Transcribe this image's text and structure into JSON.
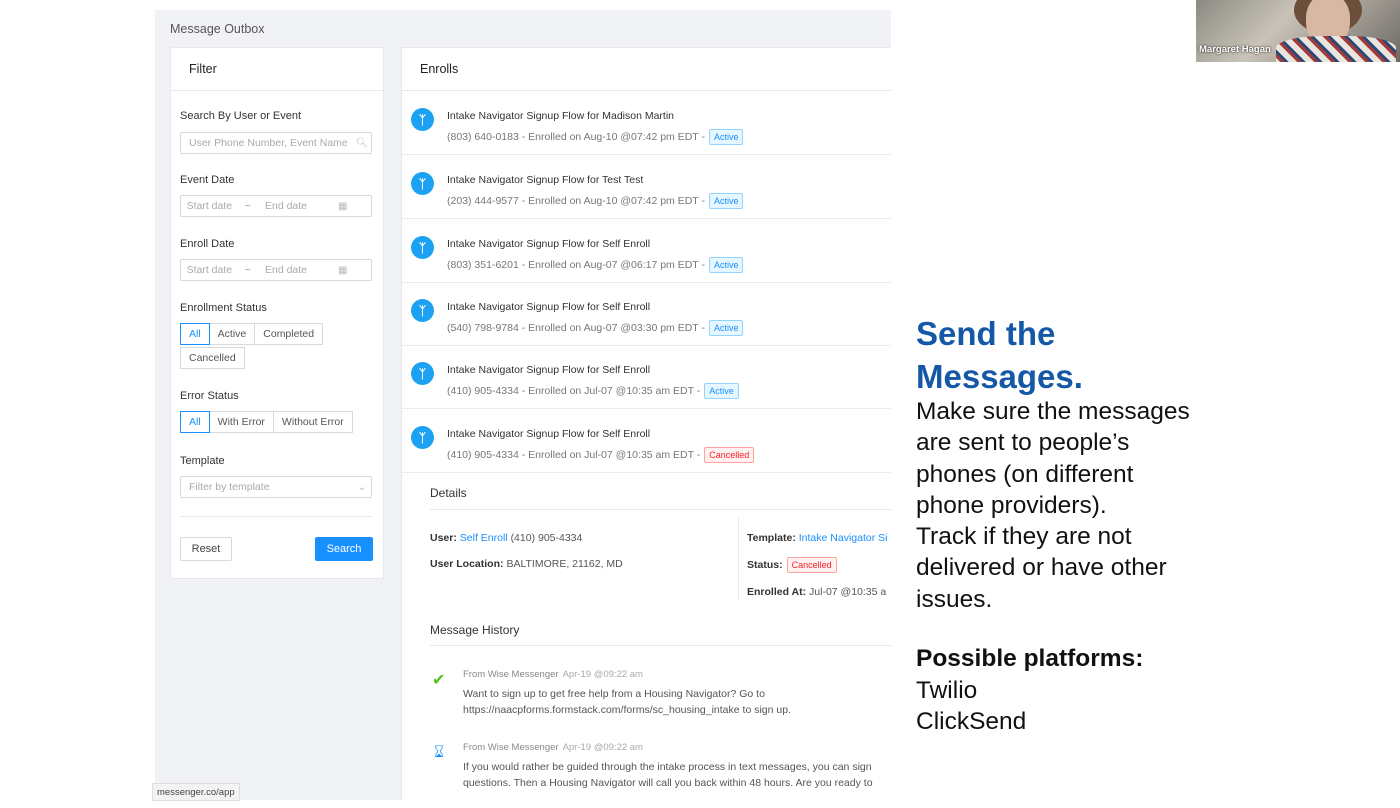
{
  "app": {
    "title": "Message Outbox",
    "filter": {
      "heading": "Filter",
      "search_label": "Search By User or Event",
      "search_placeholder": "User Phone Number, Event Name",
      "event_date_label": "Event Date",
      "enroll_date_label": "Enroll Date",
      "start_date_placeholder": "Start date",
      "end_date_placeholder": "End date",
      "date_separator": "~",
      "enrollment_status_label": "Enrollment Status",
      "enrollment_status_options": [
        "All",
        "Active",
        "Completed",
        "Cancelled"
      ],
      "enrollment_status_selected": "All",
      "error_status_label": "Error Status",
      "error_status_options": [
        "All",
        "With Error",
        "Without Error"
      ],
      "error_status_selected": "All",
      "template_label": "Template",
      "template_placeholder": "Filter by template",
      "reset_label": "Reset",
      "search_button_label": "Search"
    },
    "enrolls": {
      "heading": "Enrolls",
      "items": [
        {
          "title": "Intake Navigator Signup Flow for Madison Martin",
          "detail": "(803) 640-0183 - Enrolled on Aug-10 @07:42 pm EDT -",
          "status": "Active"
        },
        {
          "title": "Intake Navigator Signup Flow for Test Test",
          "detail": "(203) 444-9577 - Enrolled on Aug-10 @07:42 pm EDT -",
          "status": "Active"
        },
        {
          "title": "Intake Navigator Signup Flow for Self Enroll",
          "detail": "(803) 351-6201 - Enrolled on Aug-07 @06:17 pm EDT -",
          "status": "Active"
        },
        {
          "title": "Intake Navigator Signup Flow for Self Enroll",
          "detail": "(540) 798-9784 - Enrolled on Aug-07 @03:30 pm EDT -",
          "status": "Active"
        },
        {
          "title": "Intake Navigator Signup Flow for Self Enroll",
          "detail": "(410) 905-4334 - Enrolled on Jul-07 @10:35 am EDT -",
          "status": "Active"
        },
        {
          "title": "Intake Navigator Signup Flow for Self Enroll",
          "detail": "(410) 905-4334 - Enrolled on Jul-07 @10:35 am EDT -",
          "status": "Cancelled"
        }
      ]
    },
    "details": {
      "heading": "Details",
      "user_label": "User:",
      "user_link": "Self Enroll",
      "user_phone": "(410) 905-4334",
      "location_label": "User Location:",
      "location_value": "BALTIMORE, 21162, MD",
      "template_label": "Template:",
      "template_value": "Intake Navigator Si",
      "status_label": "Status:",
      "status_value": "Cancelled",
      "enrolled_label": "Enrolled At:",
      "enrolled_value": "Jul-07 @10:35 a"
    },
    "message_history": {
      "heading": "Message History",
      "messages": [
        {
          "icon": "check-circle-icon",
          "from": "From Wise Messenger",
          "time": "Apr-19 @09:22 am",
          "line1": "Want to sign up to get free help from a Housing Navigator? Go to",
          "line2": "https://naacpforms.formstack.com/forms/sc_housing_intake to sign up."
        },
        {
          "icon": "hourglass-icon",
          "from": "From Wise Messenger",
          "time": "Apr-19 @09:22 am",
          "line1": "If you would rather be guided through the intake process in text messages, you can sign",
          "line2": "questions. Then a Housing Navigator will call you back within 48 hours. Are you ready to"
        }
      ]
    },
    "status_bar_url": "messenger.co/app"
  },
  "slide": {
    "title_line1": "Send the",
    "title_line2": "Messages.",
    "body_lines": [
      "Make sure the messages",
      "are sent to people’s",
      "phones (on different",
      "phone providers).",
      "Track if they are not",
      "delivered or have other",
      "issues."
    ],
    "platforms_heading": "Possible platforms:",
    "platforms": [
      "Twilio",
      "ClickSend"
    ]
  },
  "video": {
    "participant_name": "Margaret Hagan"
  },
  "colors": {
    "accent": "#1890ff",
    "slide_title": "#1558a7",
    "cancelled": "#f5222d"
  }
}
